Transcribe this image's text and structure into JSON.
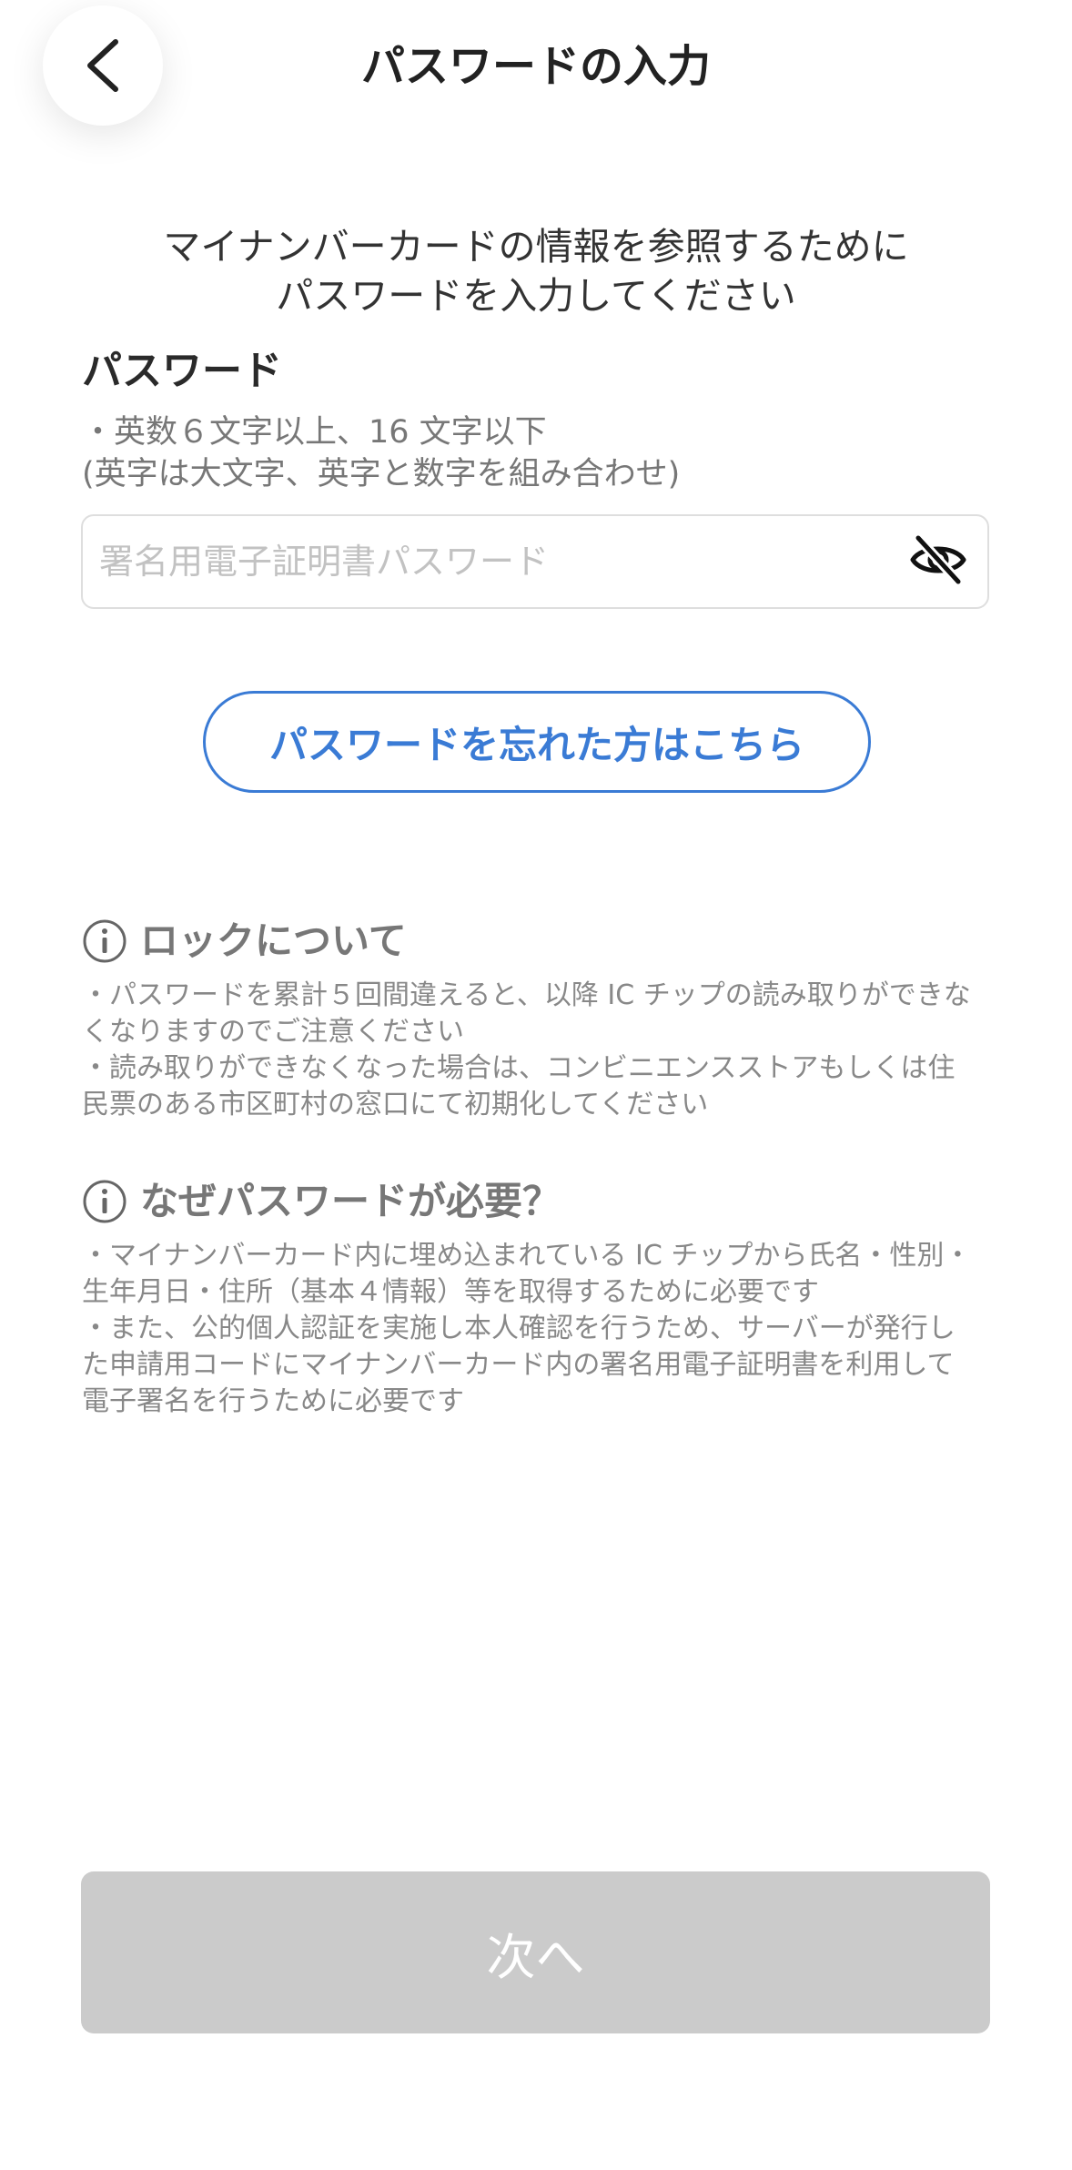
{
  "header": {
    "title": "パスワードの入力",
    "back_icon": "chevron-left-icon"
  },
  "intro": {
    "line1": "マイナンバーカードの情報を参照するために",
    "line2": "パスワードを入力してください"
  },
  "password": {
    "label": "パスワード",
    "rule_line1": "・英数６文字以上、16 文字以下",
    "rule_line2": "(英字は大文字、英字と数字を組み合わせ)",
    "value": "",
    "placeholder": "署名用電子証明書パスワード",
    "visibility_icon": "eye-off-icon"
  },
  "forgot_button": {
    "label": "パスワードを忘れた方はこちら"
  },
  "lock_info": {
    "icon": "info-icon",
    "title": "ロックについて",
    "lines": [
      "・パスワードを累計５回間違えると、以降 IC チップの読み取りができな",
      "くなりますのでご注意ください",
      "・読み取りができなくなった場合は、コンビニエンスストアもしくは住",
      "民票のある市区町村の窓口にて初期化してください"
    ]
  },
  "why_info": {
    "icon": "info-icon",
    "title": "なぜパスワードが必要？",
    "lines": [
      "・マイナンバーカード内に埋め込まれている IC チップから氏名・性別・",
      "生年月日・住所（基本４情報）等を取得するために必要です",
      "・また、公的個人認証を実施し本人確認を行うため、サーバーが発行し",
      "た申請用コードにマイナンバーカード内の署名用電子証明書を利用して",
      "電子署名を行うために必要です"
    ]
  },
  "next_button": {
    "label": "次へ"
  },
  "colors": {
    "accent": "#3a7bd5",
    "disabled_button": "#cbcbcb",
    "muted_text": "#777777"
  }
}
